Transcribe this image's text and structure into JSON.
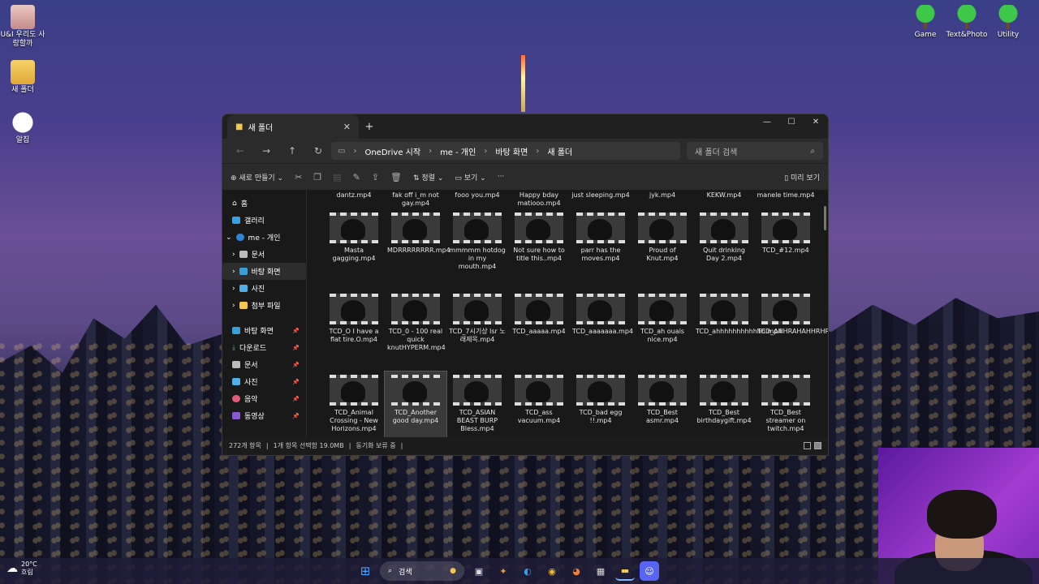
{
  "desktop": {
    "left_icons": [
      {
        "label": "U&I 우리도 사랑할까",
        "icon": "profile-photo-icon"
      },
      {
        "label": "새 폴더",
        "icon": "folder-icon"
      },
      {
        "label": "알집",
        "icon": "alzip-icon"
      }
    ],
    "right_icons": [
      {
        "label": "Game",
        "icon": "tree-icon"
      },
      {
        "label": "Text&Photo",
        "icon": "tree-icon"
      },
      {
        "label": "Utility",
        "icon": "tree-icon"
      }
    ]
  },
  "explorer": {
    "tab_title": "새 폴더",
    "breadcrumb": [
      "OneDrive 시작",
      "me - 개인",
      "바탕 화면",
      "새 폴더"
    ],
    "search_placeholder": "새 폴더 검색",
    "toolbar": {
      "new_label": "새로 만들기",
      "sort_label": "정렬",
      "view_label": "보기",
      "more_label": "···",
      "preview_label": "미리 보기"
    },
    "nav": {
      "home": "홈",
      "gallery": "갤러리",
      "onedrive": "me - 개인",
      "od_children": [
        "문서",
        "바탕 화면",
        "사진",
        "첨부 파일"
      ],
      "quick": [
        "바탕 화면",
        "다운로드",
        "문서",
        "사진",
        "음악",
        "동영상"
      ]
    },
    "top_row": [
      "dantz.mp4",
      "fak off i_m not gay.mp4",
      "fooo you.mp4",
      "Happy bday matiooo.mp4",
      "just sleeping.mp4",
      "jyk.mp4",
      "KEKW.mp4",
      "manele time.mp4"
    ],
    "files": [
      "Masta gagging.mp4",
      "MDRRRRRRRR.mp4",
      "mmmmm hotdog in my mouth.mp4",
      "Not sure how to title this..mp4",
      "parr has the moves.mp4",
      "Proud of Knut.mp4",
      "Quit drinking Day 2.mp4",
      "TCD_#12.mp4",
      "TCD_O I have a flat tire.O.mp4",
      "TCD_0 - 100 real quick knutHYPERM.mp4",
      "TCD_7시기상 lsr 노래제목.mp4",
      "TCD_aaaaa.mp4",
      "TCD_aaaaaaa.mp4",
      "TCD_ah ouais nice.mp4",
      "TCD_ahhhhhhhhhhhh.mp4",
      "TCD_AHHRAHAHHRHR.mp4",
      "TCD_Animal Crossing - New Horizons.mp4",
      "TCD_Another good day.mp4",
      "TCD_ASIAN BEAST BURP Bless.mp4",
      "TCD_ass vacuum.mp4",
      "TCD_bad egg !!.mp4",
      "TCD_Best asmr.mp4",
      "TCD_Best birthdaygift.mp4",
      "TCD_Best streamer on twitch.mp4"
    ],
    "selected_file": "TCD_Another good day.mp4",
    "status": {
      "count": "272개 항목",
      "selection": "1개 항목 선택함 19.0MB",
      "sync": "동기화 보류 중"
    }
  },
  "taskbar": {
    "weather_temp": "20°C",
    "weather_text": "흐림",
    "search_label": "검색"
  }
}
